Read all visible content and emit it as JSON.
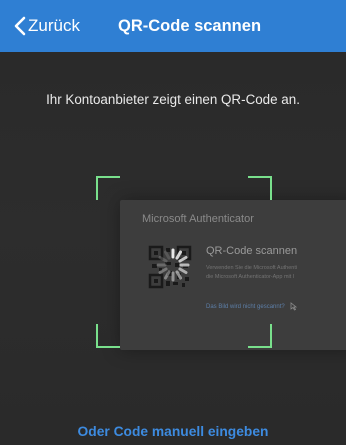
{
  "navbar": {
    "back_label": "Zurück",
    "title": "QR-Code scannen",
    "color": "#2f7fd3"
  },
  "instruction": "Ihr Kontoanbieter zeigt einen QR-Code an.",
  "background_screen": {
    "app_title": "Microsoft Authenticator",
    "heading": "QR-Code scannen",
    "line1": "Verwenden Sie die Microsoft Authenti",
    "line2": "die Microsoft Authenticator-App mit I",
    "link": "Das Bild wird nicht gescannt?"
  },
  "scan_frame_color": "#79e08c",
  "manual_entry_label": "Oder Code manuell eingeben",
  "icons": [
    "chevron-left-icon",
    "qr-code-icon",
    "loading-spinner-icon",
    "cursor-icon"
  ]
}
